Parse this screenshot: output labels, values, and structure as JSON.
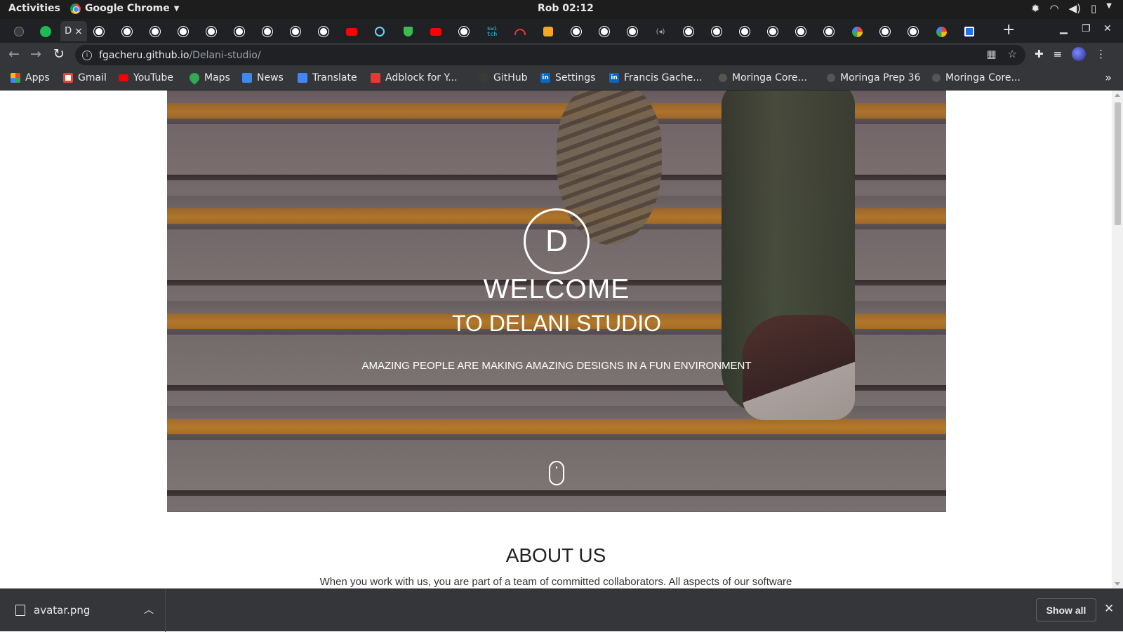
{
  "desktop": {
    "activities": "Activities",
    "app_name": "Google Chrome",
    "clock": "Rob 02:12"
  },
  "tabs": {
    "active_title_fragment": "D",
    "close_glyph": "×",
    "new_tab": "+"
  },
  "toolbar": {
    "url_host": "fgacheru.github.io",
    "url_path": "/Delani-studio/"
  },
  "bookmarks": [
    {
      "label": "Apps",
      "icon": "apps-grid-icon"
    },
    {
      "label": "Gmail",
      "icon": "gmail-icon"
    },
    {
      "label": "YouTube",
      "icon": "youtube-icon"
    },
    {
      "label": "Maps",
      "icon": "maps-icon"
    },
    {
      "label": "News",
      "icon": "news-icon"
    },
    {
      "label": "Translate",
      "icon": "translate-icon"
    },
    {
      "label": "Adblock for Y...",
      "icon": "adblock-icon"
    },
    {
      "label": "GitHub",
      "icon": "github-icon"
    },
    {
      "label": "Settings",
      "icon": "linkedin-icon"
    },
    {
      "label": "Francis Gache...",
      "icon": "linkedin-icon"
    },
    {
      "label": "Moringa Core...",
      "icon": "moringa-icon"
    },
    {
      "label": "Moringa Prep 36",
      "icon": "moringa-icon"
    },
    {
      "label": "Moringa Core...",
      "icon": "moringa-icon"
    }
  ],
  "page": {
    "hero": {
      "logo_letter": "D",
      "title": "WELCOME",
      "subtitle": "TO DELANI STUDIO",
      "tagline": "AMAZING PEOPLE ARE MAKING AMAZING DESIGNS IN A FUN ENVIRONMENT"
    },
    "about": {
      "title": "ABOUT US",
      "text": "When you work with us, you are part of a team of committed collaborators. All aspects of our software"
    }
  },
  "downloads": {
    "file_name": "avatar.png",
    "show_all": "Show all"
  },
  "colors": {
    "chrome_dark": "#35363a",
    "tabstrip": "#202124",
    "stair_orange": "#e59f2a"
  }
}
